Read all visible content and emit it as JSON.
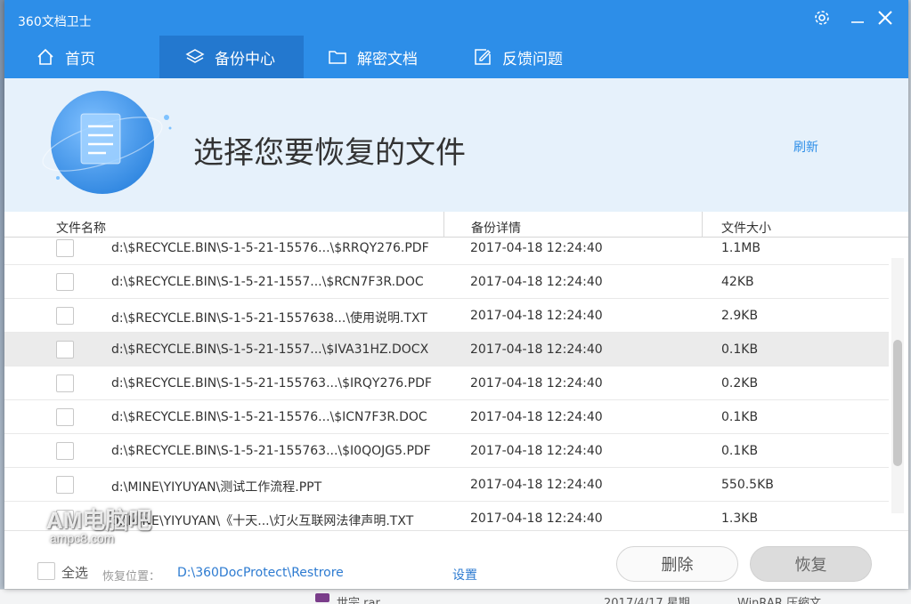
{
  "app": {
    "title": "360文档卫士"
  },
  "window_controls": {
    "settings": "gear-icon",
    "minimize": "minimize-icon",
    "close": "close-icon"
  },
  "tabs": [
    {
      "label": "首页",
      "icon": "home-icon",
      "active": false
    },
    {
      "label": "备份中心",
      "icon": "layers-icon",
      "active": true
    },
    {
      "label": "解密文档",
      "icon": "folder-icon",
      "active": false
    },
    {
      "label": "反馈问题",
      "icon": "edit-icon",
      "active": false
    }
  ],
  "banner": {
    "title": "选择您要恢复的文件",
    "refresh": "刷新"
  },
  "table": {
    "headers": {
      "name": "文件名称",
      "detail": "备份详情",
      "size": "文件大小"
    },
    "rows": [
      {
        "name": "d:\\$RECYCLE.BIN\\S-1-5-21-15576...\\$RRQY276.PDF",
        "time": "2017-04-18 12:24:40",
        "size": "1.1MB"
      },
      {
        "name": "d:\\$RECYCLE.BIN\\S-1-5-21-1557...\\$RCN7F3R.DOC",
        "time": "2017-04-18 12:24:40",
        "size": "42KB"
      },
      {
        "name": "d:\\$RECYCLE.BIN\\S-1-5-21-1557638...\\使用说明.TXT",
        "time": "2017-04-18 12:24:40",
        "size": "2.9KB"
      },
      {
        "name": "d:\\$RECYCLE.BIN\\S-1-5-21-1557...\\$IVA31HZ.DOCX",
        "time": "2017-04-18 12:24:40",
        "size": "0.1KB"
      },
      {
        "name": "d:\\$RECYCLE.BIN\\S-1-5-21-155763...\\$IRQY276.PDF",
        "time": "2017-04-18 12:24:40",
        "size": "0.2KB"
      },
      {
        "name": "d:\\$RECYCLE.BIN\\S-1-5-21-15576...\\$ICN7F3R.DOC",
        "time": "2017-04-18 12:24:40",
        "size": "0.1KB"
      },
      {
        "name": "d:\\$RECYCLE.BIN\\S-1-5-21-155763...\\$I0QOJG5.PDF",
        "time": "2017-04-18 12:24:40",
        "size": "0.1KB"
      },
      {
        "name": "d:\\MINE\\YIYUYAN\\测试工作流程.PPT",
        "time": "2017-04-18 12:24:40",
        "size": "550.5KB"
      },
      {
        "name": "d:\\MINE\\YIYUYAN\\《十天...\\灯火互联网法律声明.TXT",
        "time": "2017-04-18 12:24:40",
        "size": "1.3KB"
      }
    ]
  },
  "footer": {
    "select_all": "全选",
    "restore_location_label": "恢复位置：",
    "restore_path": "D:\\360DocProtect\\Restrore",
    "settings": "设置",
    "delete": "删除",
    "restore": "恢复"
  },
  "watermark": {
    "line1": "AM电脑吧",
    "line2": "ampc8.com"
  },
  "background_row": {
    "name": "世宗.rar",
    "date": "2017/4/17 星期",
    "type": "WinRAR 压缩文"
  },
  "colors": {
    "brand": "#2d8ee8",
    "tab_active": "#2378cf",
    "banner_bg": "#e6f1fb",
    "link": "#2d7bd1"
  }
}
